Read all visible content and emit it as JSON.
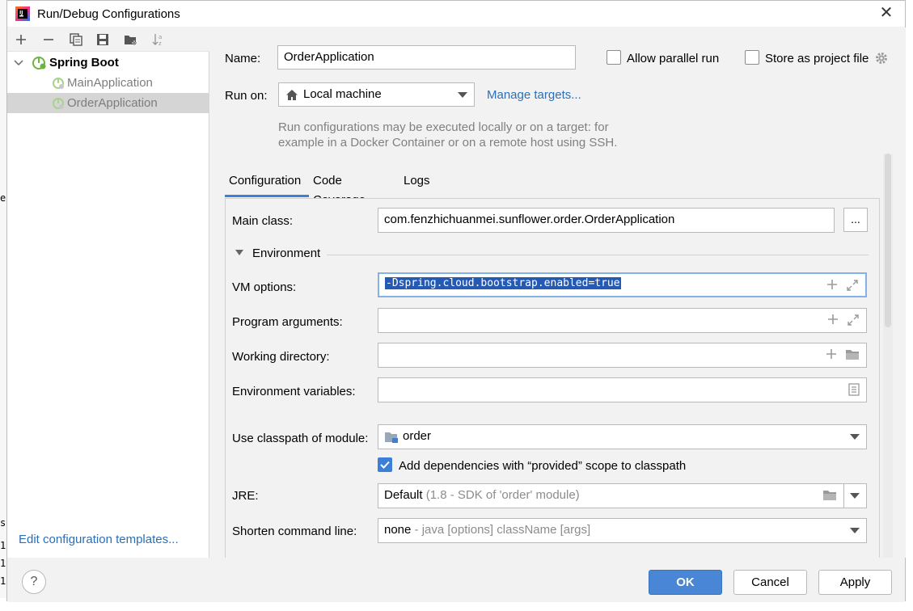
{
  "window": {
    "title": "Run/Debug Configurations",
    "close_glyph": "✕"
  },
  "toolbar": {
    "icons": [
      "add-icon",
      "remove-icon",
      "copy-icon",
      "save-icon",
      "new-folder-icon",
      "sort-icon"
    ]
  },
  "tree": {
    "group": "Spring Boot",
    "items": [
      {
        "label": "MainApplication",
        "selected": false
      },
      {
        "label": "OrderApplication",
        "selected": true
      }
    ]
  },
  "left_footer": {
    "edit_templates": "Edit configuration templates..."
  },
  "form": {
    "name_label": "Name:",
    "name_value": "OrderApplication",
    "allow_parallel_label": "Allow parallel run",
    "allow_parallel_checked": false,
    "store_project_label": "Store as project file",
    "store_project_checked": false,
    "run_on_label": "Run on:",
    "run_on_value": "Local machine",
    "manage_targets": "Manage targets...",
    "hint_line1": "Run configurations may be executed locally or on a target: for",
    "hint_line2": "example in a Docker Container or on a remote host using SSH."
  },
  "tabs": [
    {
      "label": "Configuration",
      "active": true
    },
    {
      "label": "Code Coverage",
      "active": false
    },
    {
      "label": "Logs",
      "active": false
    }
  ],
  "config": {
    "main_class_label": "Main class:",
    "main_class_value": "com.fenzhichuanmei.sunflower.order.OrderApplication",
    "ellipsis": "...",
    "environment_label": "Environment",
    "vm_options_label": "VM options:",
    "vm_options_value": "-Dspring.cloud.bootstrap.enabled=true",
    "program_args_label": "Program arguments:",
    "program_args_value": "",
    "working_dir_label": "Working directory:",
    "working_dir_value": "",
    "env_vars_label": "Environment variables:",
    "env_vars_value": "",
    "classpath_label": "Use classpath of module:",
    "classpath_value": "order",
    "add_deps_label": "Add dependencies with “provided” scope to classpath",
    "add_deps_checked": true,
    "jre_label": "JRE:",
    "jre_value": "Default",
    "jre_hint": "(1.8 - SDK of 'order' module)",
    "shorten_label": "Shorten command line:",
    "shorten_value": "none",
    "shorten_hint": "- java [options] className [args]"
  },
  "footer": {
    "help": "?",
    "ok": "OK",
    "cancel": "Cancel",
    "apply": "Apply"
  },
  "colors": {
    "accent": "#3d7ed6",
    "link": "#2a6fb8",
    "spring": "#6db33f",
    "selection": "#2459b4"
  }
}
